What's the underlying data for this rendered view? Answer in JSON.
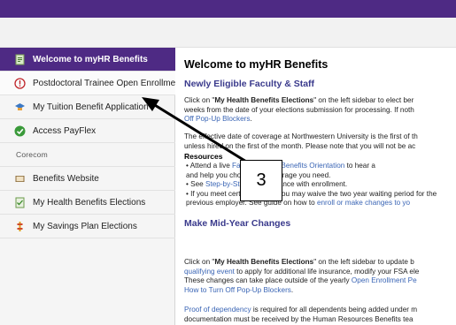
{
  "sidebar": {
    "items": [
      {
        "label": "Welcome to myHR Benefits",
        "icon": "document-icon"
      },
      {
        "label": "Postdoctoral Trainee Open Enrollment",
        "icon": "alert-icon"
      },
      {
        "label": "My Tuition Benefit Application",
        "icon": "graduation-cap-icon"
      },
      {
        "label": "Access PayFlex",
        "icon": "check-circle-icon"
      },
      {
        "label": "Corecom",
        "icon": "corecom-logo"
      },
      {
        "label": "Benefits Website",
        "icon": "book-icon"
      },
      {
        "label": "My Health Benefits Elections",
        "icon": "form-icon"
      },
      {
        "label": "My Savings Plan Elections",
        "icon": "piggy-bank-icon"
      }
    ]
  },
  "main": {
    "title": "Welcome to myHR Benefits",
    "section1": {
      "heading": "Newly Eligible Faculty & Staff",
      "p1_line1_pre": "Click on \"",
      "p1_line1_bold": "My Health Benefits Elections",
      "p1_line1_post": "\" on the left sidebar to elect ber",
      "p1_line2": "weeks from the date of your elections submission for processing. If noth",
      "p1_line3_link": "Off Pop-Up Blockers",
      "p1_line3_post": ".",
      "p2_line1": "The effective date of coverage at Northwestern University is the first of th",
      "p2_line2": "unless hired on the first of the month. Please note that you will not be ac",
      "resources_title": "Resources",
      "bullet1_pre": "• Attend a live ",
      "bullet1_link": "Faculty & Staff Benefits Orientation",
      "bullet1_post": " to hear a",
      "bullet1_line2": "   and help you choose the coverage you need.",
      "bullet2_pre": "• See ",
      "bullet2_link": "Step-by-Step",
      "bullet2_post": " for assistance with enrollment.",
      "bullet3_line1": "• If you meet certain criteria, you may waive the two year waiting period for the",
      "bullet3_line2_pre": "   previous employer. See guide on how to ",
      "bullet3_line2_link": "enroll or make changes to yo"
    },
    "section2": {
      "heading": "Make Mid-Year Changes",
      "p1_line1_pre": "Click on \"",
      "p1_line1_bold": "My Health Benefits Elections",
      "p1_line1_post": "\" on the left sidebar to update b",
      "p1_line2_link": "qualifying event",
      "p1_line2_post": " to apply for additional life insurance, modify your FSA ele",
      "p1_line3_pre": "These changes can take place outside of the yearly ",
      "p1_line3_link": "Open Enrollment Pe",
      "p1_line4_link": "How to Turn Off Pop-Up Blockers",
      "p1_line4_post": ".",
      "p2_line1_link": "Proof of dependency",
      "p2_line1_post": " is required for all dependents being added under m",
      "p2_line2": "documentation must be received by the Human Resources Benefits tea"
    }
  },
  "annotation": {
    "callout_number": "3"
  },
  "colors": {
    "brand": "#4e2a84",
    "link": "#3a65b5",
    "heading": "#3a3a8c"
  }
}
